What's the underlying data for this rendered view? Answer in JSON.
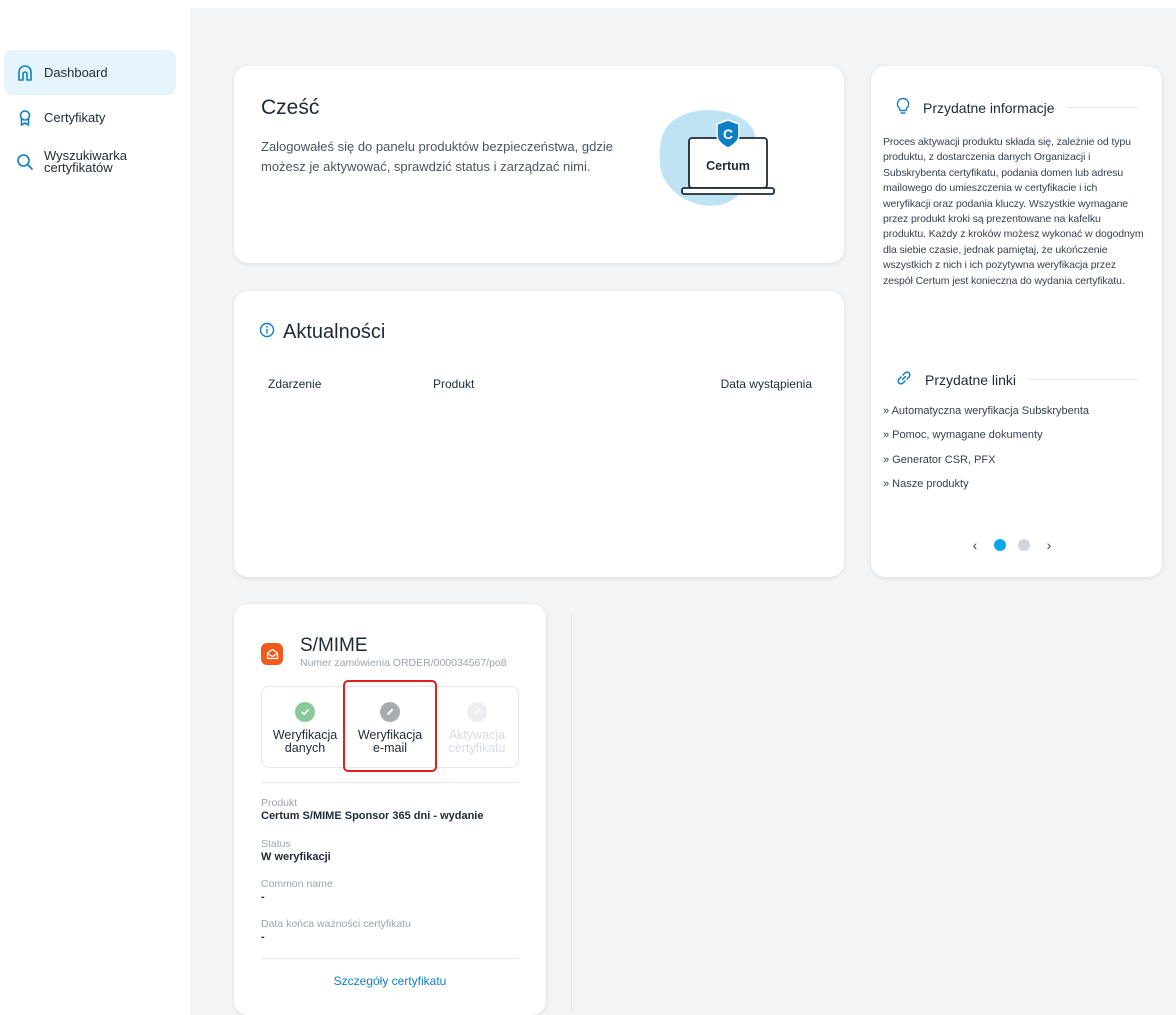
{
  "sidebar": {
    "items": [
      {
        "label": "Dashboard",
        "icon": "home-icon",
        "active": true
      },
      {
        "label": "Certyfikaty",
        "icon": "badge-icon",
        "active": false
      },
      {
        "label": "Wyszukiwarka certyfikatów",
        "label_line1": "Wyszukiwarka",
        "label_line2": "certyfikatów",
        "icon": "search-icon",
        "active": false
      }
    ]
  },
  "hello": {
    "title": "Cześć",
    "text": "Zalogowałeś się do panelu produktów bezpieczeństwa, gdzie możesz je aktywować, sprawdzić status i zarządzać nimi.",
    "logo_text": "Certum"
  },
  "news": {
    "title": "Aktualności",
    "columns": [
      "Zdarzenie",
      "Produkt",
      "Data wystąpienia"
    ]
  },
  "info": {
    "title": "Przydatne informacje",
    "text": "Proces aktywacji produktu składa się, zależnie od typu produktu, z dostarczenia danych Organizacji i Subskrybenta certyfikatu, podania domen lub adresu mailowego do umieszczenia w certyfikacie i ich weryfikacji oraz podania kluczy. Wszystkie wymagane przez produkt kroki są prezentowane na kafelku produktu. Każdy z kroków możesz wykonać w dogodnym dla siebie czasie, jednak pamiętaj, że ukończenie wszystkich z nich i ich pozytywna weryfikacja przez zespół Certum jest konieczna do wydania certyfikatu.",
    "links_title": "Przydatne linki",
    "links": [
      "» Automatyczna weryfikacja Subskrybenta",
      "» Pomoc, wymagane dokumenty",
      "» Generator CSR, PFX",
      "» Nasze produkty"
    ],
    "carousel": {
      "prev": "‹",
      "next": "›",
      "pages": 2,
      "current": 1
    }
  },
  "smime": {
    "title": "S/MIME",
    "order": "Numer zamówienia ORDER/000034567/po8",
    "steps": [
      {
        "line1": "Weryfikacja",
        "line2": "danych",
        "state": "done"
      },
      {
        "line1": "Weryfikacja",
        "line2": "e-mail",
        "state": "current"
      },
      {
        "line1": "Aktywacja",
        "line2": "certyfikatu",
        "state": "disabled"
      }
    ],
    "fields": [
      {
        "label": "Produkt",
        "value": "Certum S/MIME Sponsor 365 dni - wydanie"
      },
      {
        "label": "Status",
        "value": "W weryfikacji"
      },
      {
        "label": "Common name",
        "value": "-"
      },
      {
        "label": "Data końca ważności certyfikatu",
        "value": "-"
      }
    ],
    "details_link": "Szczegóły certyfikatu"
  },
  "colors": {
    "accent": "#0ea5e9",
    "smime_orange": "#f05a1a",
    "done_green": "#8cc99a",
    "highlight_red": "#e11d1d",
    "link_blue": "#0f7fc4"
  }
}
